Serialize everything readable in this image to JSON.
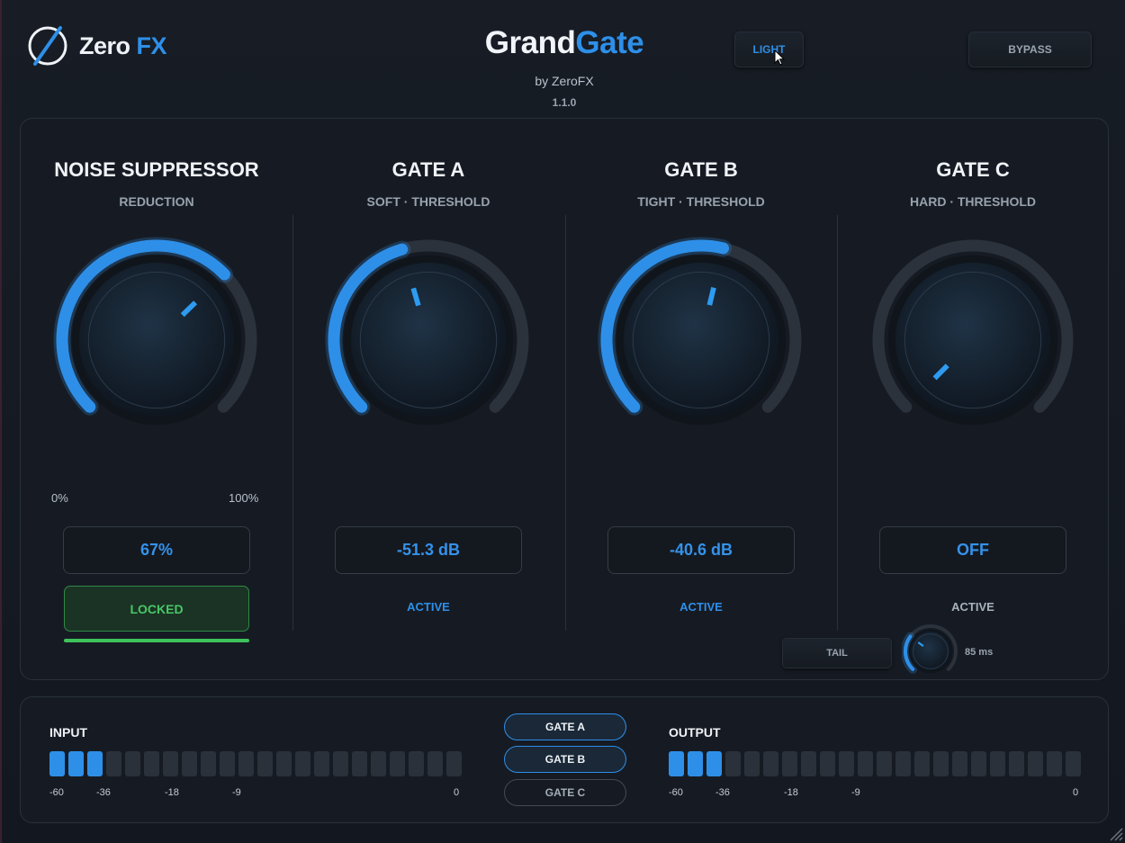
{
  "brand": {
    "name_a": "Zero",
    "name_b": "FX"
  },
  "title": {
    "part_a": "Grand",
    "part_b": "Gate",
    "byline": "by ZeroFX",
    "version": "1.1.0"
  },
  "header": {
    "light_label": "LIGHT",
    "bypass_label": "BYPASS"
  },
  "modules": [
    {
      "title": "NOISE SUPPRESSOR",
      "subtitle": "REDUCTION",
      "value": "67%",
      "range_min": "0%",
      "range_max": "100%",
      "status": "LOCKED",
      "level": 0.67
    },
    {
      "title": "GATE A",
      "subtitle": "SOFT · THRESHOLD",
      "value": "-51.3 dB",
      "status": "ACTIVE",
      "level": 0.44
    },
    {
      "title": "GATE B",
      "subtitle": "TIGHT · THRESHOLD",
      "value": "-40.6 dB",
      "status": "ACTIVE",
      "level": 0.55
    },
    {
      "title": "GATE C",
      "subtitle": "HARD · THRESHOLD",
      "value": "OFF",
      "status": "ACTIVE",
      "level": 0.0
    }
  ],
  "tail": {
    "label": "TAIL",
    "value": "85 ms",
    "level": 0.3
  },
  "meters": {
    "input": {
      "label": "INPUT",
      "lit": 3,
      "segments": 22,
      "ticks": [
        "-60",
        "-36",
        "-18",
        "-9",
        "0"
      ]
    },
    "output": {
      "label": "OUTPUT",
      "lit": 3,
      "segments": 22,
      "ticks": [
        "-60",
        "-36",
        "-18",
        "-9",
        "0"
      ]
    }
  },
  "gate_select": {
    "options": [
      "GATE A",
      "GATE B",
      "GATE C"
    ],
    "active": [
      "GATE A",
      "GATE B"
    ]
  },
  "colors": {
    "accent": "#2e8fe8",
    "locked_green": "#3ec35a",
    "background": "#151a22"
  }
}
